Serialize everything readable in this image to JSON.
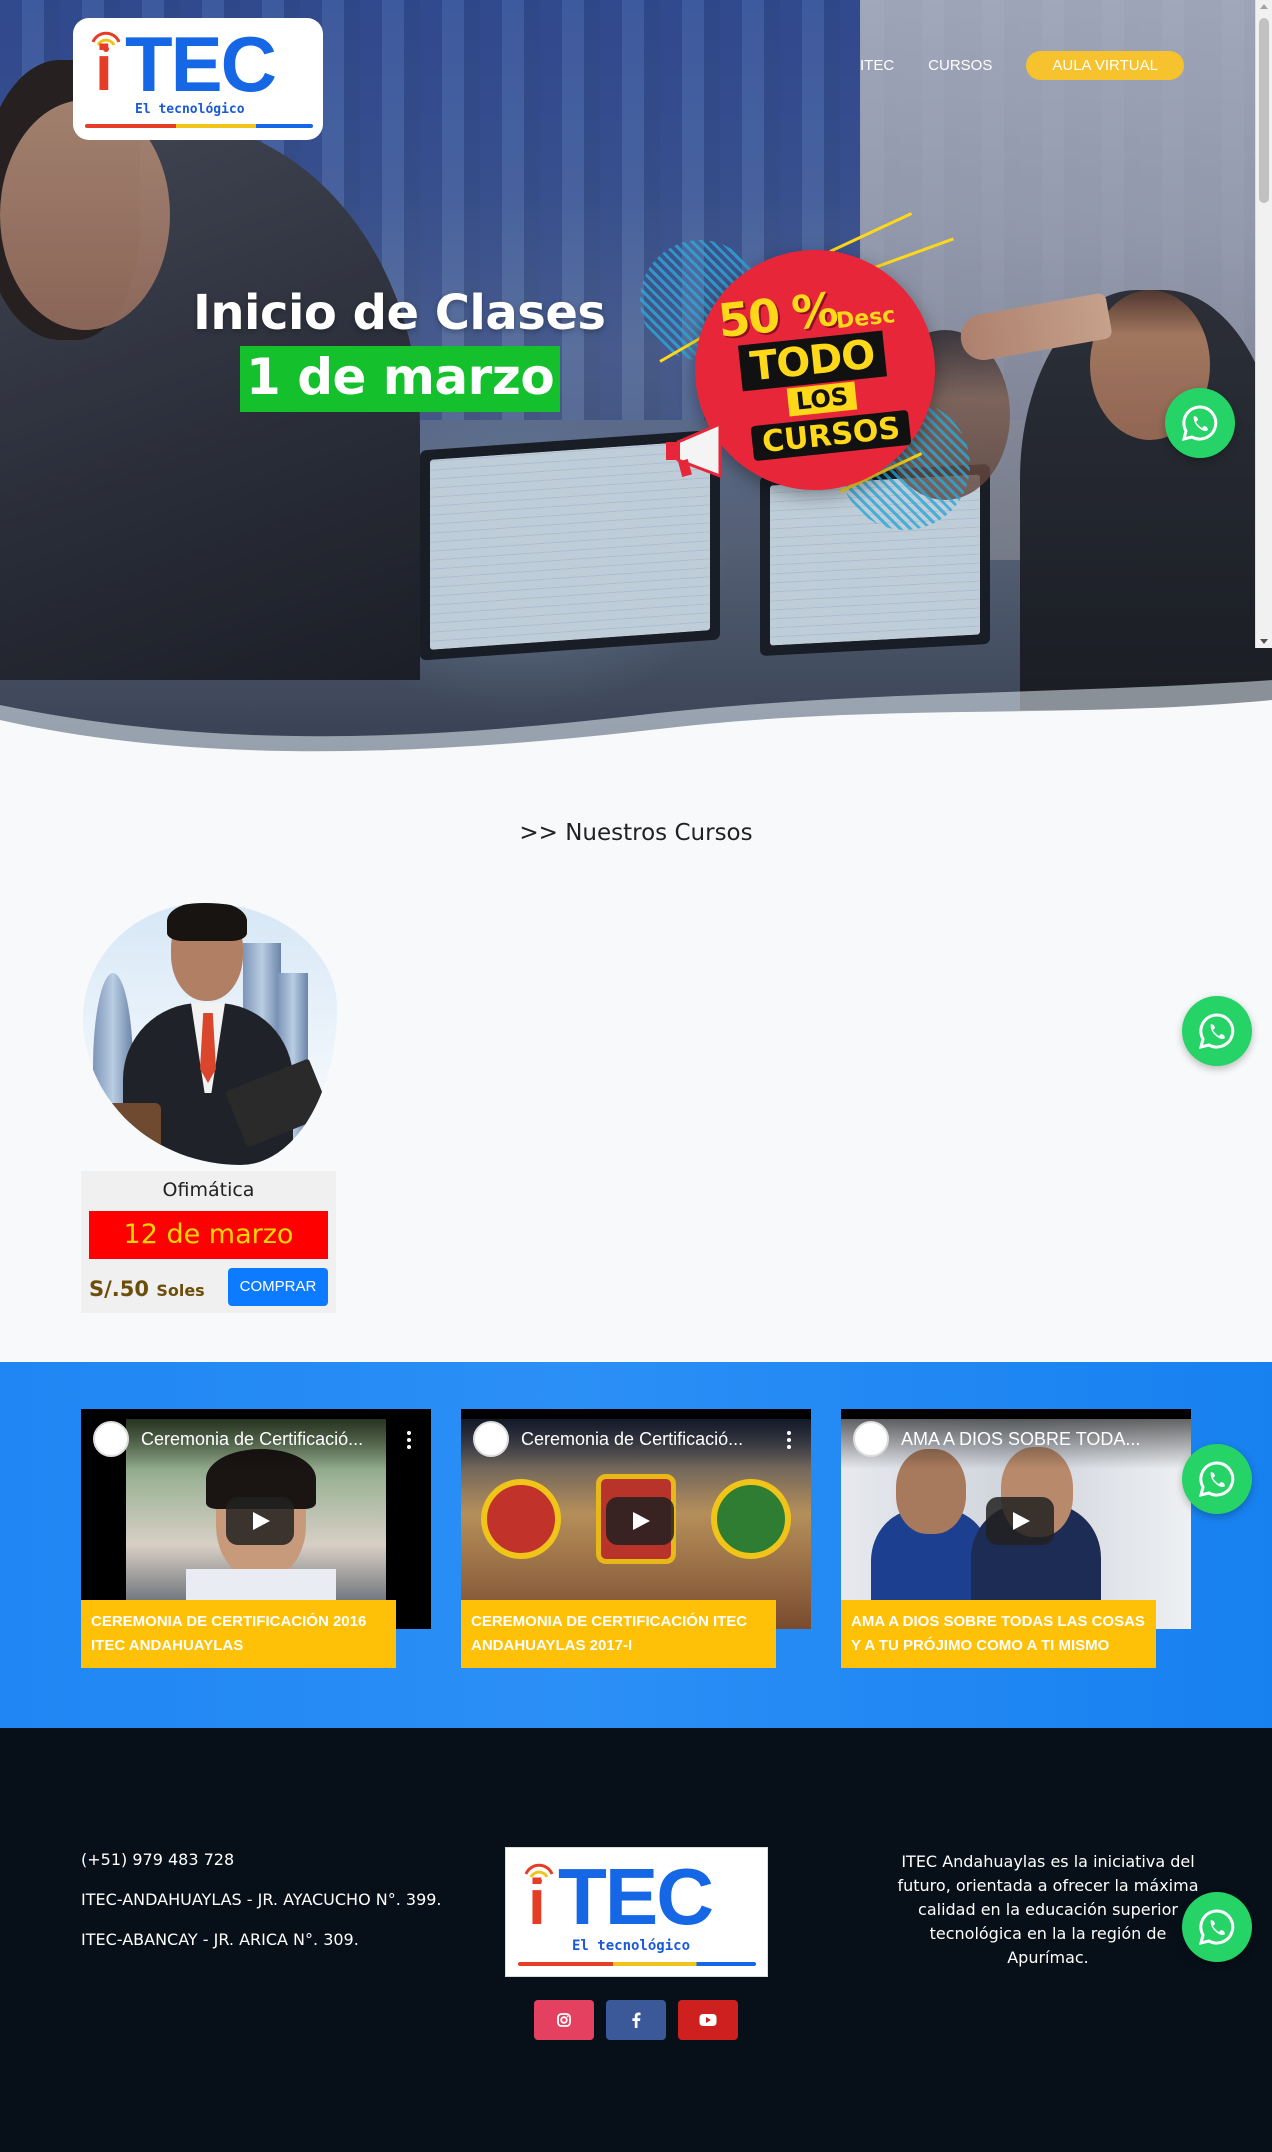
{
  "brand": {
    "logo_mark": "i",
    "logo_word": "TEC",
    "logo_tagline": "El tecnológico"
  },
  "nav": {
    "items": [
      {
        "label": "ITEC"
      },
      {
        "label": "CURSOS"
      }
    ],
    "cta_label": "AULA VIRTUAL"
  },
  "hero": {
    "title": "Inicio de Clases",
    "date": "1 de marzo",
    "promo": {
      "percent": "50 %",
      "desc": "Desc",
      "line1": "TODO",
      "line2": "LOS",
      "line3": "CURSOS"
    }
  },
  "courses_section": {
    "title": ">> Nuestros Cursos",
    "courses": [
      {
        "name": "Ofimática",
        "start_date": "12 de marzo",
        "price": "S/.50",
        "currency_word": "Soles",
        "buy_label": "COMPRAR"
      }
    ]
  },
  "videos": [
    {
      "player_title": "Ceremonia de Certificació...",
      "caption": "CEREMONIA DE CERTIFICACIÓN 2016 ITEC ANDAHUAYLAS"
    },
    {
      "player_title": "Ceremonia de Certificació...",
      "caption": "CEREMONIA DE CERTIFICACIÓN ITEC ANDAHUAYLAS 2017-I"
    },
    {
      "player_title": "AMA A DIOS SOBRE TODA...",
      "caption": "AMA A DIOS SOBRE TODAS LAS COSAS Y A TU PRÓJIMO COMO A TI MISMO"
    }
  ],
  "footer": {
    "phone": "(+51) 979 483 728",
    "address1": "ITEC-ANDAHUAYLAS - JR. AYACUCHO N°. 399.",
    "address2": "ITEC-ABANCAY - JR. ARICA N°. 309.",
    "about": "ITEC Andahuaylas es la iniciativa del futuro, orientada a ofrecer la máxima calidad en la educación superior tecnológica en la la región de Apurímac.",
    "social": [
      {
        "icon": "instagram-icon",
        "color": "#e4405f"
      },
      {
        "icon": "facebook-icon",
        "color": "#3b5998"
      },
      {
        "icon": "youtube-icon",
        "color": "#cd201f"
      }
    ]
  },
  "colors": {
    "accent_yellow": "#f6c22e",
    "hero_date_green": "#14c12d",
    "promo_red": "#e8263a",
    "course_date_red": "#ff0000",
    "button_blue": "#0d7bff",
    "videos_band_blue": "#1f86f3",
    "caption_yellow": "#ffc107",
    "footer_bg": "#070f19",
    "whatsapp_green": "#25d366"
  },
  "floating": {
    "icon": "whatsapp-icon"
  }
}
